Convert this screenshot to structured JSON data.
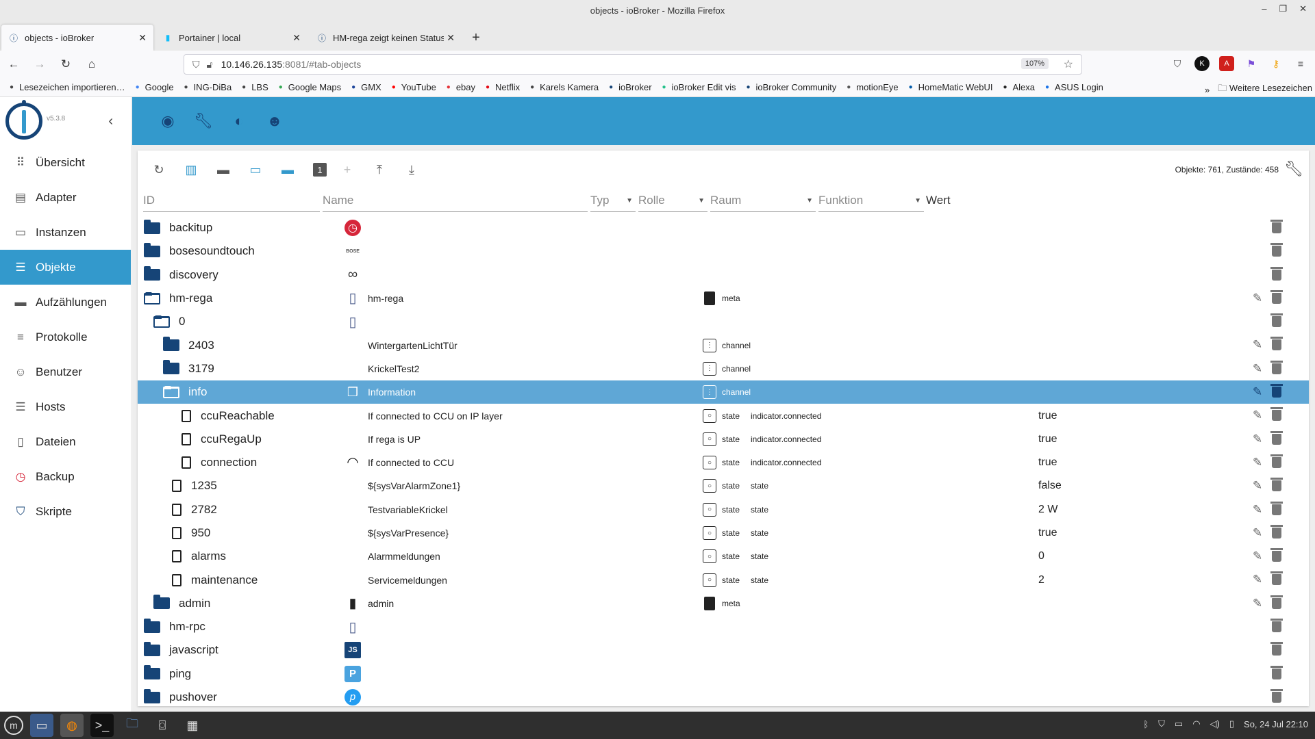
{
  "window": {
    "title": "objects - ioBroker - Mozilla Firefox"
  },
  "tabs": [
    {
      "label": "objects - ioBroker",
      "active": true,
      "icon": "iobroker-icon"
    },
    {
      "label": "Portainer | local",
      "active": false,
      "icon": "portainer-icon"
    },
    {
      "label": "HM-rega zeigt keinen Status",
      "active": false,
      "icon": "iobroker-icon"
    }
  ],
  "url": {
    "host": "10.146.26.135",
    "rest": ":8081/#tab-objects",
    "zoom": "107%"
  },
  "bookmarks": [
    {
      "label": "Lesezeichen importieren…",
      "icon": "import-icon",
      "color": "#444"
    },
    {
      "label": "Google",
      "icon": "google-icon",
      "color": "#4285f4"
    },
    {
      "label": "ING-DiBa",
      "icon": "globe-icon",
      "color": "#444"
    },
    {
      "label": "LBS",
      "icon": "globe-icon",
      "color": "#444"
    },
    {
      "label": "Google Maps",
      "icon": "maps-icon",
      "color": "#34a853"
    },
    {
      "label": "GMX",
      "icon": "gmx-icon",
      "color": "#1c449b"
    },
    {
      "label": "YouTube",
      "icon": "youtube-icon",
      "color": "#ff0000"
    },
    {
      "label": "ebay",
      "icon": "ebay-icon",
      "color": "#e53238"
    },
    {
      "label": "Netflix",
      "icon": "netflix-icon",
      "color": "#e50914"
    },
    {
      "label": "Karels Kamera",
      "icon": "globe-icon",
      "color": "#444"
    },
    {
      "label": "ioBroker",
      "icon": "iobroker-icon",
      "color": "#164477"
    },
    {
      "label": "ioBroker Edit vis",
      "icon": "vis-icon",
      "color": "#22c08a"
    },
    {
      "label": "ioBroker Community",
      "icon": "iobroker-icon",
      "color": "#164477"
    },
    {
      "label": "motionEye",
      "icon": "motioneye-icon",
      "color": "#555"
    },
    {
      "label": "HomeMatic WebUI",
      "icon": "homematic-icon",
      "color": "#005aa9"
    },
    {
      "label": "Alexa",
      "icon": "amazon-icon",
      "color": "#222"
    },
    {
      "label": "ASUS Login",
      "icon": "asus-icon",
      "color": "#1a73e8"
    }
  ],
  "bookmarks_more": "Weitere Lesezeichen",
  "app": {
    "version": "v5.3.8",
    "nav": [
      {
        "label": "Übersicht",
        "icon": "grid-icon",
        "active": false
      },
      {
        "label": "Adapter",
        "icon": "store-icon",
        "active": false
      },
      {
        "label": "Instanzen",
        "icon": "instances-icon",
        "active": false
      },
      {
        "label": "Objekte",
        "icon": "list-icon",
        "active": true
      },
      {
        "label": "Aufzählungen",
        "icon": "enum-icon",
        "active": false
      },
      {
        "label": "Protokolle",
        "icon": "log-icon",
        "active": false
      },
      {
        "label": "Benutzer",
        "icon": "user-icon",
        "active": false
      },
      {
        "label": "Hosts",
        "icon": "hosts-icon",
        "active": false
      },
      {
        "label": "Dateien",
        "icon": "files-icon",
        "active": false
      },
      {
        "label": "Backup",
        "icon": "backup-icon",
        "active": false
      },
      {
        "label": "Skripte",
        "icon": "js-icon",
        "active": false
      }
    ],
    "topbar_icons": [
      "eye-icon",
      "wrench-icon",
      "theme-icon",
      "expert-icon"
    ],
    "counts": "Objekte: 761, Zustände: 458",
    "filters": {
      "id": "ID",
      "name": "Name",
      "typ": "Typ",
      "rolle": "Rolle",
      "raum": "Raum",
      "funktion": "Funktion",
      "wert": "Wert"
    },
    "rows": [
      {
        "id": "backitup",
        "indent": 0,
        "kind": "folder",
        "icon": "backitup-icon",
        "name": "",
        "type": "",
        "typeicon": "",
        "role": "",
        "value": "",
        "edit": false,
        "selected": false
      },
      {
        "id": "bosesoundtouch",
        "indent": 0,
        "kind": "folder",
        "icon": "bose-icon",
        "name": "",
        "type": "",
        "typeicon": "",
        "role": "",
        "value": "",
        "edit": false,
        "selected": false
      },
      {
        "id": "discovery",
        "indent": 0,
        "kind": "folder",
        "icon": "binoculars-icon",
        "name": "",
        "type": "",
        "typeicon": "",
        "role": "",
        "value": "",
        "edit": false,
        "selected": false
      },
      {
        "id": "hm-rega",
        "indent": 0,
        "kind": "folder-open",
        "icon": "hmrega-icon",
        "name": "hm-rega",
        "type": "meta",
        "typeicon": "meta",
        "role": "",
        "value": "",
        "edit": true,
        "selected": false
      },
      {
        "id": "0",
        "indent": 1,
        "kind": "folder-open",
        "icon": "hmrega-icon",
        "name": "",
        "type": "",
        "typeicon": "",
        "role": "",
        "value": "",
        "edit": false,
        "selected": false
      },
      {
        "id": "2403",
        "indent": 2,
        "kind": "folder",
        "icon": "",
        "name": "WintergartenLichtTür",
        "type": "channel",
        "typeicon": "channel",
        "role": "",
        "value": "",
        "edit": true,
        "selected": false
      },
      {
        "id": "3179",
        "indent": 2,
        "kind": "folder",
        "icon": "",
        "name": "KrickelTest2",
        "type": "channel",
        "typeicon": "channel",
        "role": "",
        "value": "",
        "edit": true,
        "selected": false
      },
      {
        "id": "info",
        "indent": 2,
        "kind": "folder-open",
        "icon": "copy-icon",
        "name": "Information",
        "type": "channel",
        "typeicon": "channel",
        "role": "",
        "value": "",
        "edit": true,
        "selected": true
      },
      {
        "id": "ccuReachable",
        "indent": 3,
        "kind": "doc",
        "icon": "",
        "name": "If connected to CCU on IP layer",
        "type": "state",
        "typeicon": "state",
        "role": "indicator.connected",
        "value": "true",
        "edit": true,
        "selected": false
      },
      {
        "id": "ccuRegaUp",
        "indent": 3,
        "kind": "doc",
        "icon": "",
        "name": "If rega is UP",
        "type": "state",
        "typeicon": "state",
        "role": "indicator.connected",
        "value": "true",
        "edit": true,
        "selected": false
      },
      {
        "id": "connection",
        "indent": 3,
        "kind": "doc",
        "icon": "wifi-icon",
        "name": "If connected to CCU",
        "type": "state",
        "typeicon": "state",
        "role": "indicator.connected",
        "value": "true",
        "edit": true,
        "selected": false
      },
      {
        "id": "1235",
        "indent": 2,
        "kind": "doc",
        "icon": "",
        "name": "${sysVarAlarmZone1}",
        "type": "state",
        "typeicon": "state",
        "role": "state",
        "value": "false",
        "edit": true,
        "selected": false
      },
      {
        "id": "2782",
        "indent": 2,
        "kind": "doc",
        "icon": "",
        "name": "TestvariableKrickel",
        "type": "state",
        "typeicon": "state",
        "role": "state",
        "value": "2 W",
        "edit": true,
        "selected": false
      },
      {
        "id": "950",
        "indent": 2,
        "kind": "doc",
        "icon": "",
        "name": "${sysVarPresence}",
        "type": "state",
        "typeicon": "state",
        "role": "state",
        "value": "true",
        "edit": true,
        "selected": false
      },
      {
        "id": "alarms",
        "indent": 2,
        "kind": "doc",
        "icon": "",
        "name": "Alarmmeldungen",
        "type": "state",
        "typeicon": "state",
        "role": "state",
        "value": "0",
        "edit": true,
        "selected": false
      },
      {
        "id": "maintenance",
        "indent": 2,
        "kind": "doc",
        "icon": "",
        "name": "Servicemeldungen",
        "type": "state",
        "typeicon": "state",
        "role": "state",
        "value": "2",
        "edit": true,
        "selected": false
      },
      {
        "id": "admin",
        "indent": 1,
        "kind": "folder",
        "icon": "meta-doc-icon",
        "name": "admin",
        "type": "meta",
        "typeicon": "meta",
        "role": "",
        "value": "",
        "edit": true,
        "selected": false
      },
      {
        "id": "hm-rpc",
        "indent": 0,
        "kind": "folder",
        "icon": "hmrpc-icon",
        "name": "",
        "type": "",
        "typeicon": "",
        "role": "",
        "value": "",
        "edit": false,
        "selected": false
      },
      {
        "id": "javascript",
        "indent": 0,
        "kind": "folder",
        "icon": "js-icon",
        "name": "",
        "type": "",
        "typeicon": "",
        "role": "",
        "value": "",
        "edit": false,
        "selected": false
      },
      {
        "id": "ping",
        "indent": 0,
        "kind": "folder",
        "icon": "ping-icon",
        "name": "",
        "type": "",
        "typeicon": "",
        "role": "",
        "value": "",
        "edit": false,
        "selected": false
      },
      {
        "id": "pushover",
        "indent": 0,
        "kind": "folder",
        "icon": "pushover-icon",
        "name": "",
        "type": "",
        "typeicon": "",
        "role": "",
        "value": "",
        "edit": false,
        "selected": false
      }
    ]
  },
  "taskbar": {
    "clock": "So, 24 Jul 22:10"
  },
  "colors": {
    "accent": "#3399cc",
    "dark": "#164477",
    "selected_row": "#5fa7d6"
  }
}
